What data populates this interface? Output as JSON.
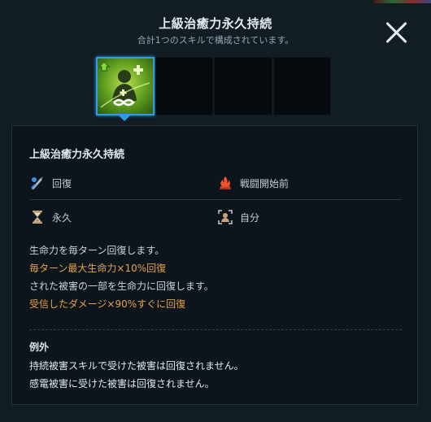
{
  "header": {
    "title": "上級治癒力永久持続",
    "subtitle": "合計1つのスキルで構成されています。"
  },
  "skill": {
    "name": "上級治癒力永久持続",
    "attributes": {
      "type": "回復",
      "timing": "戦闘開始前",
      "duration": "永久",
      "target": "自分"
    },
    "description": [
      {
        "text": "生命力を毎ターン回復します。",
        "style": "normal"
      },
      {
        "text": "毎ターン最大生命力×10%回復",
        "style": "highlight"
      },
      {
        "text": "された被害の一部を生命力に回復します。",
        "style": "normal"
      },
      {
        "text": "受信したダメージ×90%すぐに回復",
        "style": "highlight"
      }
    ],
    "exceptions": {
      "title": "例外",
      "lines": [
        "持続被害スキルで受けた被害は回復されません。",
        "感電被害に受けた被害は回復されません。"
      ]
    }
  },
  "icons": {
    "close": "close-icon",
    "type": "sword-heal-icon",
    "timing": "fire-bowl-icon",
    "duration": "hourglass-icon",
    "target": "self-target-icon",
    "skill": "heal-person-infinity-icon"
  },
  "colors": {
    "accent": "#2f9ce6",
    "highlight": "#e6a24a"
  }
}
